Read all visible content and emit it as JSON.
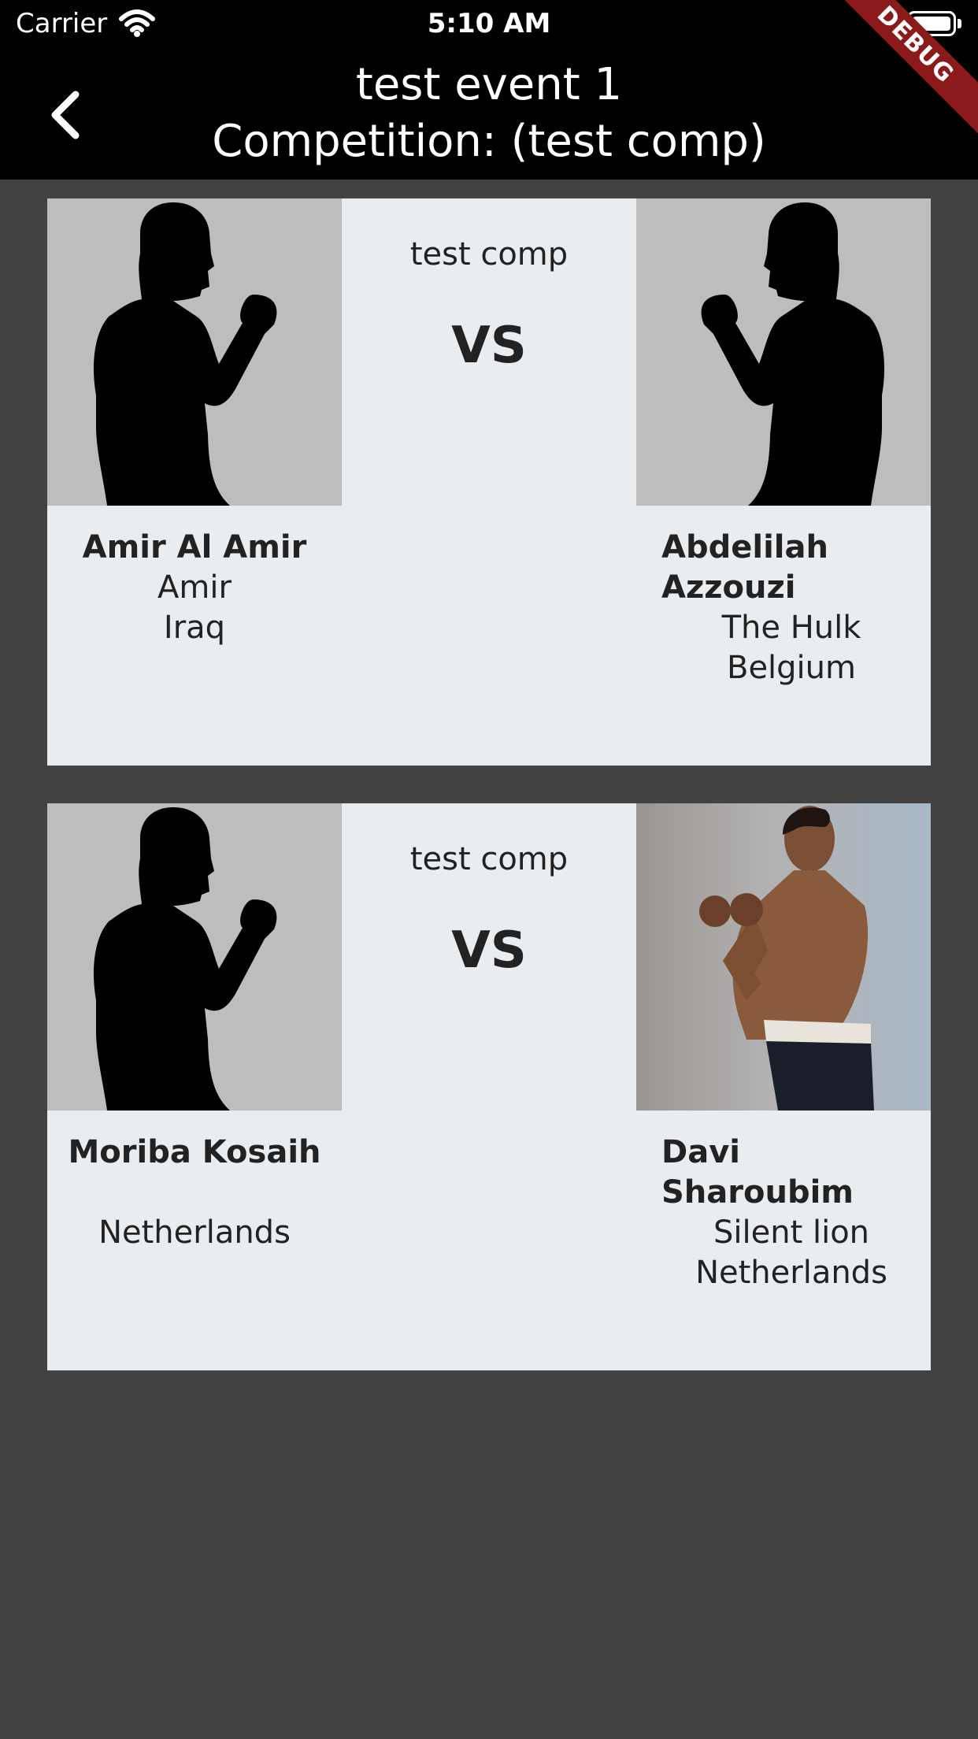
{
  "status_bar": {
    "carrier": "Carrier",
    "time": "5:10 AM"
  },
  "app_bar": {
    "title_line1": "test event 1",
    "title_line2": "Competition: (test comp)",
    "debug_banner": "DEBUG"
  },
  "matches": [
    {
      "competition": "test comp",
      "vs_label": "VS",
      "left": {
        "name": "Amir Al Amir",
        "nickname": "Amir",
        "country": "Iraq"
      },
      "right": {
        "name": "Abdelilah Azzouzi",
        "nickname": "The Hulk",
        "country": "Belgium"
      }
    },
    {
      "competition": "test comp",
      "vs_label": "VS",
      "left": {
        "name": "Moriba Kosaih",
        "nickname": "",
        "country": "Netherlands"
      },
      "right": {
        "name": "Davi Sharoubim",
        "nickname": "Silent lion",
        "country": "Netherlands"
      }
    }
  ],
  "colors": {
    "background": "#424242",
    "app_bar": "#000000",
    "card": "#eaedf0",
    "photo_placeholder": "#bdbdbd",
    "debug_banner": "#8b1a1a"
  }
}
